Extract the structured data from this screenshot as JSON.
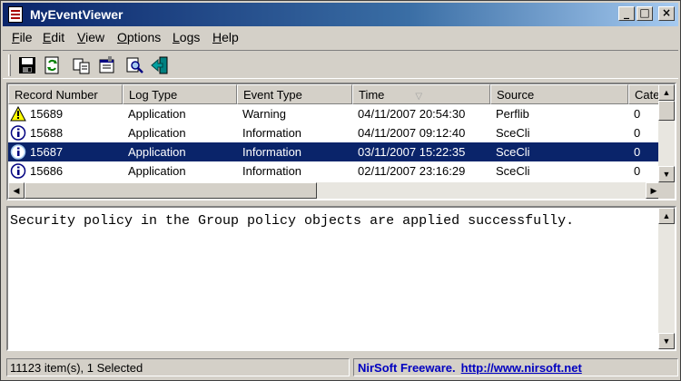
{
  "window": {
    "title": "MyEventViewer"
  },
  "menu": [
    "File",
    "Edit",
    "View",
    "Options",
    "Logs",
    "Help"
  ],
  "menu_access_keys": [
    "F",
    "E",
    "V",
    "O",
    "L",
    "H"
  ],
  "toolbar": {
    "icons": [
      "save-icon",
      "refresh-icon",
      "copy-icon",
      "properties-icon",
      "find-icon",
      "exit-icon"
    ]
  },
  "list": {
    "columns": [
      "Record Number",
      "Log Type",
      "Event Type",
      "Time",
      "Source",
      "Cate"
    ],
    "sort_column": "Time",
    "rows": [
      {
        "record": "15689",
        "log": "Application",
        "type": "Warning",
        "time": "04/11/2007 20:54:30",
        "source": "Perflib",
        "cat": "0",
        "icon": "warning-icon",
        "selected": false
      },
      {
        "record": "15688",
        "log": "Application",
        "type": "Information",
        "time": "04/11/2007 09:12:40",
        "source": "SceCli",
        "cat": "0",
        "icon": "information-icon",
        "selected": false
      },
      {
        "record": "15687",
        "log": "Application",
        "type": "Information",
        "time": "03/11/2007 15:22:35",
        "source": "SceCli",
        "cat": "0",
        "icon": "information-icon",
        "selected": true
      },
      {
        "record": "15686",
        "log": "Application",
        "type": "Information",
        "time": "02/11/2007 23:16:29",
        "source": "SceCli",
        "cat": "0",
        "icon": "information-icon",
        "selected": false
      }
    ]
  },
  "description": {
    "text": "Security policy in the Group policy objects are applied successfully."
  },
  "status": {
    "count": "11123 item(s), 1 Selected",
    "brand": "NirSoft Freeware.",
    "url": "http://www.nirsoft.net"
  },
  "colors": {
    "selection": "#0a246a",
    "link": "#0000c0",
    "face": "#d4d0c8"
  }
}
